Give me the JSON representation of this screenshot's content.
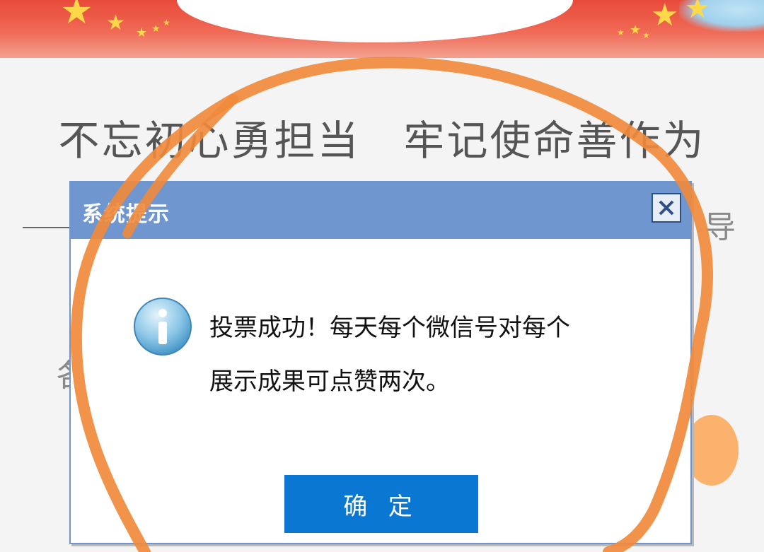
{
  "page": {
    "heading": "不忘初心勇担当　牢记使命善作为",
    "side_text_right": "导",
    "side_text_left": "各"
  },
  "dialog": {
    "title": "系统提示",
    "close_icon": "close-icon",
    "info_icon": "info-icon",
    "message_line1": "投票成功！每天每个微信号对每个",
    "message_line2": "展示成果可点赞两次。",
    "ok_label": "确 定"
  },
  "colors": {
    "header_bg": "#6f96cf",
    "ok_button_bg": "#0a78d2",
    "annotation_stroke": "#f08a3c",
    "banner_red": "#e84a3a"
  }
}
